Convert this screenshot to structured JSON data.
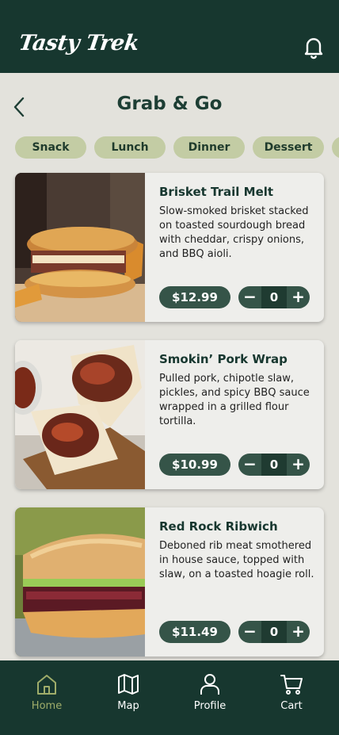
{
  "header": {
    "brand": "Tasty Trek",
    "notifications_icon": "bell-icon"
  },
  "page": {
    "title": "Grab & Go",
    "back_icon": "chevron-left-icon"
  },
  "categories": [
    "Snack",
    "Lunch",
    "Dinner",
    "Dessert"
  ],
  "items": [
    {
      "name": "Brisket Trail Melt",
      "description": "Slow-smoked brisket stacked on toasted sourdough bread with cheddar, crispy onions, and BBQ aioli.",
      "price": "$12.99",
      "quantity": "0"
    },
    {
      "name": "Smokin’ Pork Wrap",
      "description": "Pulled pork, chipotle slaw, pickles, and spicy BBQ sauce wrapped in a grilled flour tortilla.",
      "price": "$10.99",
      "quantity": "0"
    },
    {
      "name": "Red Rock Ribwich",
      "description": "Deboned rib meat smothered in house sauce, topped with slaw, on a toasted hoagie roll.",
      "price": "$11.49",
      "quantity": "0"
    }
  ],
  "controls": {
    "minus": "−",
    "plus": "+"
  },
  "nav": [
    {
      "label": "Home",
      "icon": "home-icon",
      "active": true
    },
    {
      "label": "Map",
      "icon": "map-icon",
      "active": false
    },
    {
      "label": "Profile",
      "icon": "profile-icon",
      "active": false
    },
    {
      "label": "Cart",
      "icon": "cart-icon",
      "active": false
    }
  ],
  "colors": {
    "header_bg": "#17372f",
    "chip_bg": "#c3cca4",
    "button_bg": "#355448",
    "active_nav": "#9fad6a",
    "page_bg": "#e3e2dc"
  }
}
